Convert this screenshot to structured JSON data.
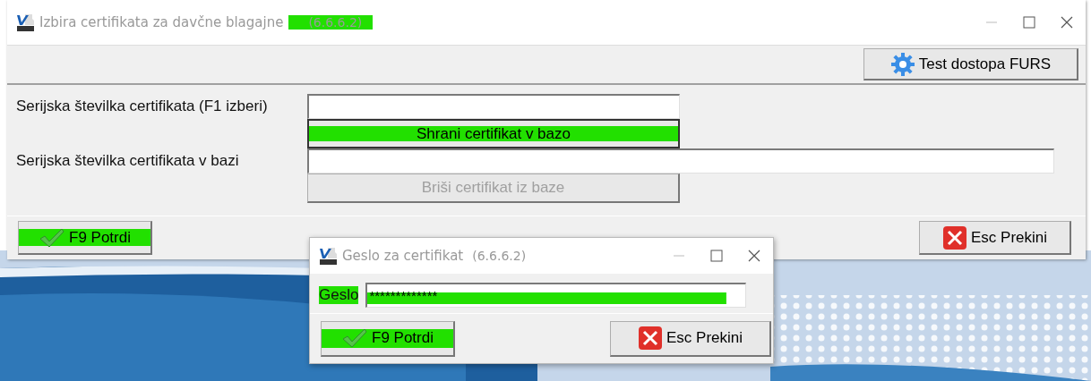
{
  "main_window": {
    "title": "Izbira certifikata za davčne blagajne",
    "version": {
      "text": "(6.6.6.2)",
      "highlighted": true
    },
    "toolbar_button": {
      "label": "Test dostopa FURS"
    },
    "certificate_field": {
      "label": "Serijska številka certifikata (F1 izberi)"
    },
    "save_button": {
      "label": "Shrani certifikat v bazo",
      "highlighted": true,
      "disabled": false
    },
    "stored_field": {
      "label": "Serijska številka certifikata v bazi"
    },
    "delete_button": {
      "label": "Briši certifikat iz baze",
      "disabled": true
    },
    "confirm_button": {
      "label": "F9 Potrdi",
      "highlighted": true
    },
    "cancel_button": {
      "label": "Esc Prekini"
    }
  },
  "dialog": {
    "title": "Geslo za certifikat",
    "version": {
      "text": "(6.6.6.2)"
    },
    "password_field": {
      "label": "Geslo",
      "value": "*************",
      "highlighted": true
    },
    "confirm_button": {
      "label": "F9 Potrdi",
      "highlighted": true
    },
    "cancel_button": {
      "label": "Esc Prekini"
    }
  }
}
